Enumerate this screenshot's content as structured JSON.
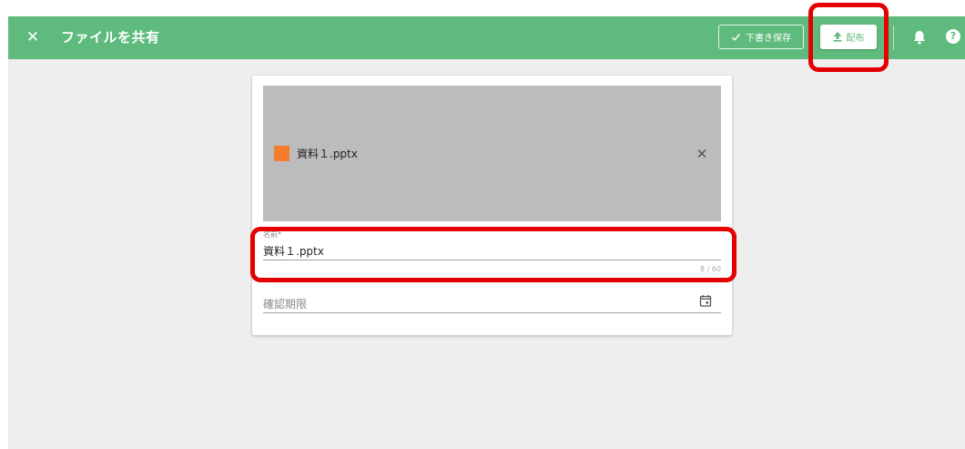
{
  "appbar": {
    "title": "ファイルを共有",
    "close_icon": "close-icon",
    "draft_label": "下書き保存",
    "distribute_label": "配布",
    "color": "#5fba7d"
  },
  "preview": {
    "file_name": "資料１.pptx",
    "file_type_color": "#f57c2b"
  },
  "form": {
    "name_label": "名前*",
    "name_value": "資料１.pptx",
    "name_counter": "8 / 60",
    "deadline_placeholder": "確認期限"
  },
  "annotations": {
    "highlight_color": "#e40000"
  }
}
